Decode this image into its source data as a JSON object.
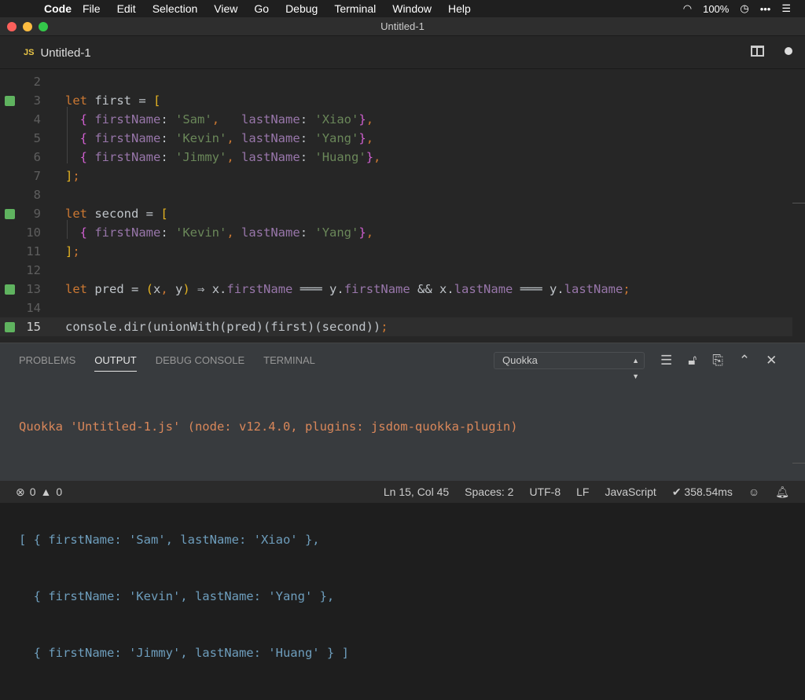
{
  "menubar": {
    "app": "Code",
    "items": [
      "File",
      "Edit",
      "Selection",
      "View",
      "Go",
      "Debug",
      "Terminal",
      "Window",
      "Help"
    ],
    "battery": "100%"
  },
  "window": {
    "title": "Untitled-1"
  },
  "tab": {
    "lang_badge": "JS",
    "label": "Untitled-1"
  },
  "editor": {
    "current_line": 15,
    "lines": [
      {
        "n": 2,
        "tokens": []
      },
      {
        "n": 3,
        "marker": true,
        "tokens": [
          [
            "let",
            "kw"
          ],
          [
            " first = ",
            "id"
          ],
          [
            "[",
            "br"
          ]
        ]
      },
      {
        "n": 4,
        "tokens": [
          [
            "  ",
            "id"
          ],
          [
            "{",
            "bc"
          ],
          [
            " firstName",
            "pr"
          ],
          [
            ": ",
            "id"
          ],
          [
            "'Sam'",
            "st"
          ],
          [
            ",",
            "pu"
          ],
          [
            "   lastName",
            "pr"
          ],
          [
            ": ",
            "id"
          ],
          [
            "'Xiao'",
            "st"
          ],
          [
            "}",
            "bc"
          ],
          [
            ",",
            "pu"
          ]
        ]
      },
      {
        "n": 5,
        "tokens": [
          [
            "  ",
            "id"
          ],
          [
            "{",
            "bc"
          ],
          [
            " firstName",
            "pr"
          ],
          [
            ": ",
            "id"
          ],
          [
            "'Kevin'",
            "st"
          ],
          [
            ",",
            "pu"
          ],
          [
            " lastName",
            "pr"
          ],
          [
            ": ",
            "id"
          ],
          [
            "'Yang'",
            "st"
          ],
          [
            "}",
            "bc"
          ],
          [
            ",",
            "pu"
          ]
        ]
      },
      {
        "n": 6,
        "tokens": [
          [
            "  ",
            "id"
          ],
          [
            "{",
            "bc"
          ],
          [
            " firstName",
            "pr"
          ],
          [
            ": ",
            "id"
          ],
          [
            "'Jimmy'",
            "st"
          ],
          [
            ",",
            "pu"
          ],
          [
            " lastName",
            "pr"
          ],
          [
            ": ",
            "id"
          ],
          [
            "'Huang'",
            "st"
          ],
          [
            "}",
            "bc"
          ],
          [
            ",",
            "pu"
          ]
        ]
      },
      {
        "n": 7,
        "tokens": [
          [
            "]",
            "br"
          ],
          [
            ";",
            "pu"
          ]
        ]
      },
      {
        "n": 8,
        "tokens": []
      },
      {
        "n": 9,
        "marker": true,
        "tokens": [
          [
            "let",
            "kw"
          ],
          [
            " second = ",
            "id"
          ],
          [
            "[",
            "br"
          ]
        ]
      },
      {
        "n": 10,
        "tokens": [
          [
            "  ",
            "id"
          ],
          [
            "{",
            "bc"
          ],
          [
            " firstName",
            "pr"
          ],
          [
            ": ",
            "id"
          ],
          [
            "'Kevin'",
            "st"
          ],
          [
            ",",
            "pu"
          ],
          [
            " lastName",
            "pr"
          ],
          [
            ": ",
            "id"
          ],
          [
            "'Yang'",
            "st"
          ],
          [
            "}",
            "bc"
          ],
          [
            ",",
            "pu"
          ]
        ]
      },
      {
        "n": 11,
        "tokens": [
          [
            "]",
            "br"
          ],
          [
            ";",
            "pu"
          ]
        ]
      },
      {
        "n": 12,
        "tokens": []
      },
      {
        "n": 13,
        "marker": true,
        "tokens": [
          [
            "let",
            "kw"
          ],
          [
            " pred = ",
            "id"
          ],
          [
            "(",
            "br"
          ],
          [
            "x",
            "id"
          ],
          [
            ", ",
            "pu"
          ],
          [
            "y",
            "id"
          ],
          [
            ")",
            "br"
          ],
          [
            " ⇒ x.",
            "id"
          ],
          [
            "firstName",
            "pr"
          ],
          [
            " ═══ y.",
            "id"
          ],
          [
            "firstName",
            "pr"
          ],
          [
            " && x.",
            "id"
          ],
          [
            "lastName",
            "pr"
          ],
          [
            " ═══ y.",
            "id"
          ],
          [
            "lastName",
            "pr"
          ],
          [
            ";",
            "pu"
          ]
        ]
      },
      {
        "n": 14,
        "tokens": []
      },
      {
        "n": 15,
        "marker": true,
        "tokens": [
          [
            "console.dir(unionWith(pred)(first)(second))",
            "id"
          ],
          [
            ";",
            "pu"
          ]
        ]
      }
    ]
  },
  "panel": {
    "tabs": [
      "PROBLEMS",
      "OUTPUT",
      "DEBUG CONSOLE",
      "TERMINAL"
    ],
    "active_tab": "OUTPUT",
    "channel": "Quokka",
    "header": "Quokka 'Untitled-1.js' (node: v12.4.0, plugins: jsdom-quokka-plugin)",
    "output": [
      "[ { firstName: 'Sam', lastName: 'Xiao' },",
      "  { firstName: 'Kevin', lastName: 'Yang' },",
      "  { firstName: 'Jimmy', lastName: 'Huang' } ]"
    ]
  },
  "status": {
    "errors": "0",
    "warnings": "0",
    "position": "Ln 15, Col 45",
    "spaces": "Spaces: 2",
    "encoding": "UTF-8",
    "eol": "LF",
    "language": "JavaScript",
    "timing": "✔ 358.54ms"
  }
}
